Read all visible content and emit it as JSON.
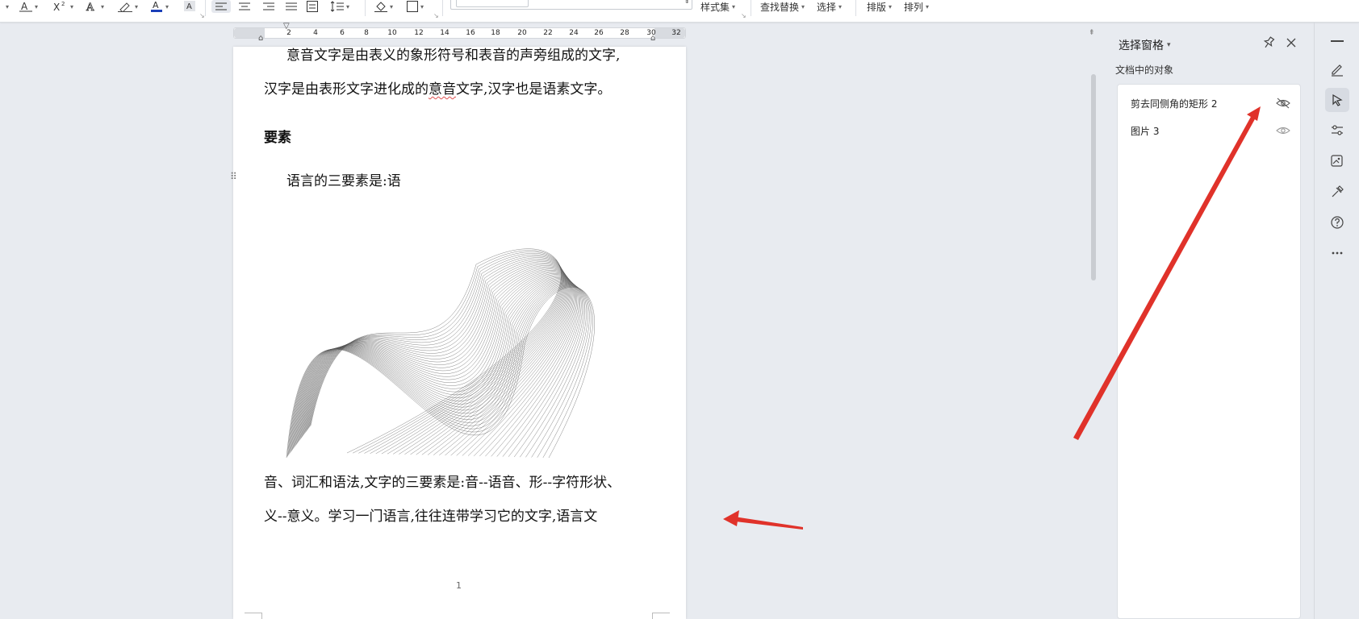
{
  "ribbon": {
    "styles_label": "样式集",
    "find_replace_label": "查找替换",
    "select_label": "选择",
    "layout_label": "排版",
    "arrange_label": "排列"
  },
  "ruler": {
    "ticks": [
      "2",
      "4",
      "6",
      "8",
      "10",
      "12",
      "14",
      "16",
      "18",
      "20",
      "22",
      "24",
      "26",
      "28",
      "30",
      "32"
    ]
  },
  "document": {
    "paragraphs": [
      "意音文字是由表义的象形符号和表音的声旁组成的文字,",
      "汉字是由表形文字进化成的",
      "意音",
      "文字,汉字也是语素文字。",
      "要素",
      "语言的三要素是:语",
      "音、词汇和语法,文字的三要素是:音--语音、形--字符形状、",
      "义--意义。学习一门语言,往往连带学习它的文字,语言文"
    ],
    "page_number": "1"
  },
  "selection_pane": {
    "title": "选择窗格",
    "subtitle": "文档中的对象",
    "objects": [
      {
        "label": "剪去同侧角的矩形 2",
        "visibility": "hidden"
      },
      {
        "label": "图片 3",
        "visibility": "visible"
      }
    ]
  },
  "colors": {
    "accent_active": "#d7dbe2",
    "annotation_arrow": "#e0322a",
    "font_color_swatch": "#1a3fb8"
  }
}
